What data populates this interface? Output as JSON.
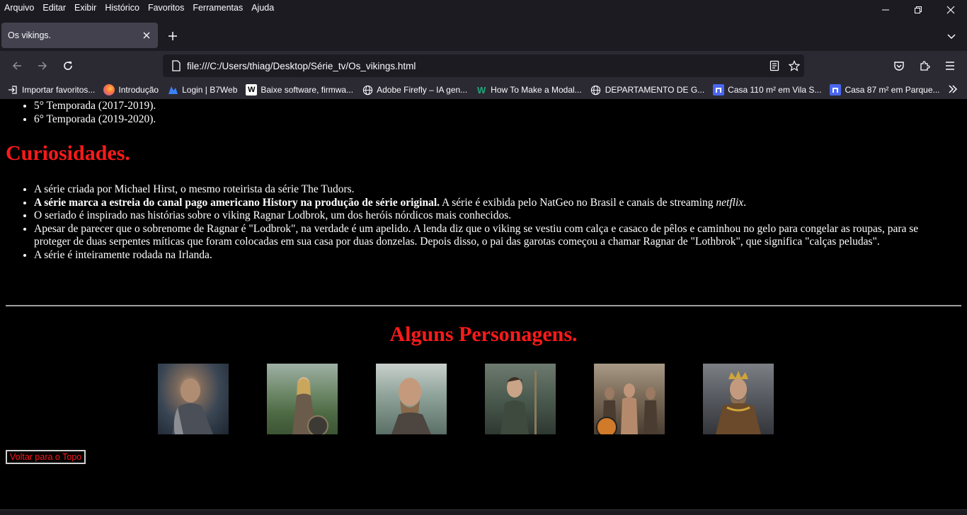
{
  "menubar": {
    "items": [
      "Arquivo",
      "Editar",
      "Exibir",
      "Histórico",
      "Favoritos",
      "Ferramentas",
      "Ajuda"
    ]
  },
  "tab": {
    "title": "Os vikings."
  },
  "urlbar": {
    "url": "file:///C:/Users/thiag/Desktop/Série_tv/Os_vikings.html"
  },
  "bookmarks": [
    {
      "label": "Importar favoritos...",
      "icon": "import-icon",
      "color": "#2b2a33"
    },
    {
      "label": "Introdução",
      "icon": "firefox-icon",
      "color": "#ff7139"
    },
    {
      "label": "Login | B7Web",
      "icon": "b7web-icon",
      "color": "#3b82f6"
    },
    {
      "label": "Baixe software, firmwa...",
      "icon": "w-logo-icon",
      "color": "#ffffff"
    },
    {
      "label": "Adobe Firefly – IA gen...",
      "icon": "globe-icon",
      "color": "#2b2a33"
    },
    {
      "label": "How To Make a Modal...",
      "icon": "w-green-icon",
      "color": "#2b2a33"
    },
    {
      "label": "DEPARTAMENTO DE G...",
      "icon": "globe-icon",
      "color": "#2b2a33"
    },
    {
      "label": "Casa 110 m² em Vila S...",
      "icon": "house-icon",
      "color": "#4a67f0"
    },
    {
      "label": "Casa 87 m² em Parque...",
      "icon": "house-icon",
      "color": "#4a67f0"
    }
  ],
  "page": {
    "seasons": [
      "5° Temporada (2017-2019).",
      "6° Temporada (2019-2020)."
    ],
    "curiosidades_title": "Curiosidades.",
    "curiosidades": {
      "item1": "A série criada por Michael Hirst, o mesmo roteirista da série The Tudors.",
      "item2_bold": "A série marca a estreia do canal pago americano History na produção de série original.",
      "item2_rest": " A série é exibida pelo NatGeo no Brasil e canais de streaming ",
      "item2_italic": "netflix",
      "item2_end": ".",
      "item3": "O seriado é inspirado nas histórias sobre o viking Ragnar Lodbrok, um dos heróis nórdicos mais conhecidos.",
      "item4": "Apesar de parecer que o sobrenome de Ragnar é \"Lodbrok\", na verdade é um apelido. A lenda diz que o viking se vestiu com calça e casaco de pêlos e caminhou no gelo para congelar as roupas, para se proteger de duas serpentes míticas que foram colocadas em sua casa por duas donzelas. Depois disso, o pai das garotas começou a chamar Ragnar de \"Lothbrok\", que significa \"calças peludas\".",
      "item5": "A série é inteiramente rodada na Irlanda."
    },
    "personagens_title": "Alguns Personagens.",
    "top_link": "Voltar para o Topo"
  }
}
